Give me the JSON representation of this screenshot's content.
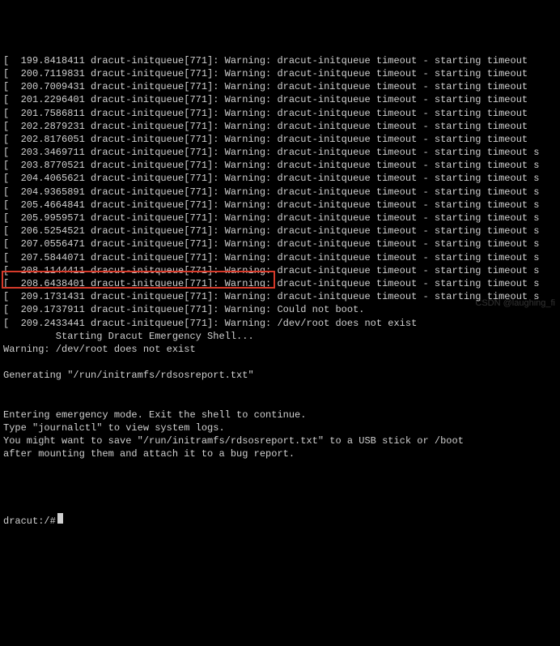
{
  "log_lines": [
    "[  199.8418411 dracut-initqueue[771]: Warning: dracut-initqueue timeout - starting timeout",
    "[  200.7119831 dracut-initqueue[771]: Warning: dracut-initqueue timeout - starting timeout",
    "[  200.7009431 dracut-initqueue[771]: Warning: dracut-initqueue timeout - starting timeout",
    "[  201.2296401 dracut-initqueue[771]: Warning: dracut-initqueue timeout - starting timeout",
    "[  201.7586811 dracut-initqueue[771]: Warning: dracut-initqueue timeout - starting timeout",
    "[  202.2879231 dracut-initqueue[771]: Warning: dracut-initqueue timeout - starting timeout",
    "[  202.8176051 dracut-initqueue[771]: Warning: dracut-initqueue timeout - starting timeout",
    "[  203.3469711 dracut-initqueue[771]: Warning: dracut-initqueue timeout - starting timeout s",
    "[  203.8770521 dracut-initqueue[771]: Warning: dracut-initqueue timeout - starting timeout s",
    "[  204.4065621 dracut-initqueue[771]: Warning: dracut-initqueue timeout - starting timeout s",
    "[  204.9365891 dracut-initqueue[771]: Warning: dracut-initqueue timeout - starting timeout s",
    "[  205.4664841 dracut-initqueue[771]: Warning: dracut-initqueue timeout - starting timeout s",
    "[  205.9959571 dracut-initqueue[771]: Warning: dracut-initqueue timeout - starting timeout s",
    "[  206.5254521 dracut-initqueue[771]: Warning: dracut-initqueue timeout - starting timeout s",
    "[  207.0556471 dracut-initqueue[771]: Warning: dracut-initqueue timeout - starting timeout s",
    "[  207.5844071 dracut-initqueue[771]: Warning: dracut-initqueue timeout - starting timeout s",
    "[  208.1144411 dracut-initqueue[771]: Warning: dracut-initqueue timeout - starting timeout s",
    "[  208.6438401 dracut-initqueue[771]: Warning: dracut-initqueue timeout - starting timeout s",
    "[  209.1731431 dracut-initqueue[771]: Warning: dracut-initqueue timeout - starting timeout s",
    "[  209.1737911 dracut-initqueue[771]: Warning: Could not boot.",
    "[  209.2433441 dracut-initqueue[771]: Warning: /dev/root does not exist",
    "         Starting Dracut Emergency Shell...",
    "Warning: /dev/root does not exist",
    "",
    "Generating \"/run/initramfs/rdsosreport.txt\"",
    "",
    "",
    "Entering emergency mode. Exit the shell to continue.",
    "Type \"journalctl\" to view system logs.",
    "You might want to save \"/run/initramfs/rdsosreport.txt\" to a USB stick or /boot",
    "after mounting them and attach it to a bug report.",
    "",
    ""
  ],
  "prompt": "dracut:/#",
  "watermark": "CSDN @laughing_fi"
}
